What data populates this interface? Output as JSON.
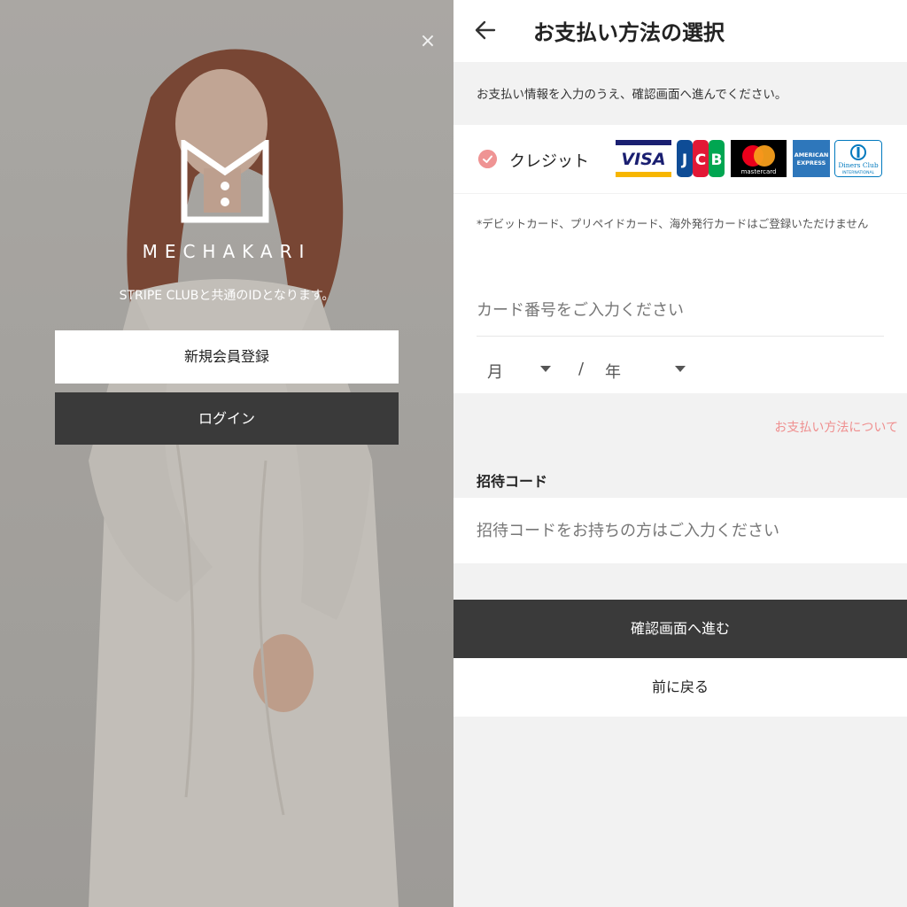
{
  "left": {
    "brand": "MECHAKARI",
    "shared_note": "STRIPE CLUBと共通のIDとなります。",
    "register_label": "新規会員登録",
    "login_label": "ログイン",
    "close_symbol": "×"
  },
  "right": {
    "title": "お支払い方法の選択",
    "intro": "お支払い情報を入力のうえ、確認画面へ進んでください。",
    "method_label": "クレジット",
    "card_brands": [
      "VISA",
      "JCB",
      "mastercard",
      "AMERICAN EXPRESS",
      "Diners Club INTERNATIONAL"
    ],
    "card_note": "*デビットカード、プリペイドカード、海外発行カードはご登録いただけません",
    "card_placeholder": "カード番号をご入力ください",
    "month_label": "月",
    "slash": "/",
    "year_label": "年",
    "about_link": "お支払い方法について",
    "invite_label": "招待コード",
    "invite_placeholder": "招待コードをお持ちの方はご入力ください",
    "confirm_label": "確認画面へ進む",
    "back_label": "前に戻る"
  },
  "colors": {
    "accent": "#ef8f8f",
    "dark_button": "#3a3a3a",
    "background": "#f2f2f2"
  }
}
